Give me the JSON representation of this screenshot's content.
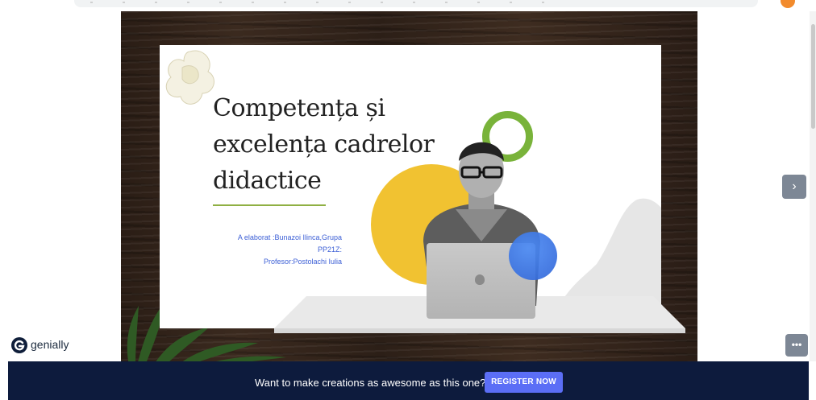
{
  "slide": {
    "title_lines": [
      "Competența și",
      "excelența cadrelor",
      "didactice"
    ],
    "credits_line1": "A elaborat :Bunazoi Ilinca,Grupa",
    "credits_line2": "PP21Z:",
    "credits_line3": "Profesor:Postolachi Iulia"
  },
  "navigation": {
    "next_icon": "›",
    "more_icon": "•••"
  },
  "branding": {
    "logo_text": "genially"
  },
  "footer": {
    "cta_text": "Want to make creations as awesome as this one?",
    "register_label": "REGISTER NOW"
  },
  "colors": {
    "footer_bg": "#0d1b3d",
    "register_bg": "#5b6ef6",
    "accent_yellow": "#f1c231",
    "accent_green": "#79b33a",
    "accent_blue": "#2e63d6",
    "credits_text": "#3c5fd6"
  }
}
